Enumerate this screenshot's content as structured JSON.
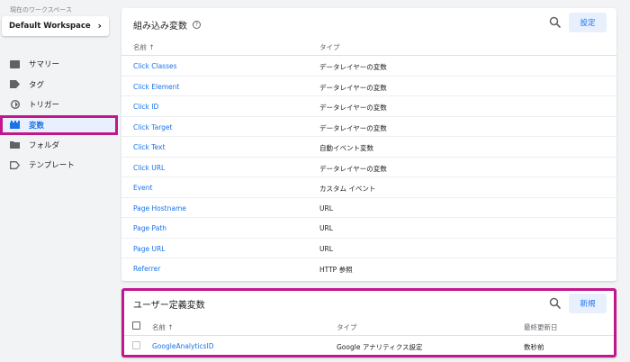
{
  "workspace": {
    "label": "現在のワークスペース",
    "name": "Default Workspace"
  },
  "nav": [
    {
      "label": "サマリー",
      "icon": "summary-icon"
    },
    {
      "label": "タグ",
      "icon": "tag-icon"
    },
    {
      "label": "トリガー",
      "icon": "trigger-icon"
    },
    {
      "label": "変数",
      "icon": "variables-icon",
      "active": true
    },
    {
      "label": "フォルダ",
      "icon": "folder-icon"
    },
    {
      "label": "テンプレート",
      "icon": "template-icon"
    }
  ],
  "builtin": {
    "title": "組み込み変数",
    "config_label": "設定",
    "col_name": "名前 ↑",
    "col_type": "タイプ",
    "rows": [
      {
        "name": "Click Classes",
        "type": "データレイヤーの変数"
      },
      {
        "name": "Click Element",
        "type": "データレイヤーの変数"
      },
      {
        "name": "Click ID",
        "type": "データレイヤーの変数"
      },
      {
        "name": "Click Target",
        "type": "データレイヤーの変数"
      },
      {
        "name": "Click Text",
        "type": "自動イベント変数"
      },
      {
        "name": "Click URL",
        "type": "データレイヤーの変数"
      },
      {
        "name": "Event",
        "type": "カスタム イベント"
      },
      {
        "name": "Page Hostname",
        "type": "URL"
      },
      {
        "name": "Page Path",
        "type": "URL"
      },
      {
        "name": "Page URL",
        "type": "URL"
      },
      {
        "name": "Referrer",
        "type": "HTTP 参照"
      }
    ]
  },
  "userdefined": {
    "title": "ユーザー定義変数",
    "new_label": "新規",
    "col_name": "名前 ↑",
    "col_type": "タイプ",
    "col_updated": "最終更新日",
    "rows": [
      {
        "name": "GoogleAnalyticsID",
        "type": "Google アナリティクス設定",
        "updated": "数秒前"
      }
    ]
  },
  "colors": {
    "accent": "#1a73e8",
    "highlight": "#c2168f"
  }
}
